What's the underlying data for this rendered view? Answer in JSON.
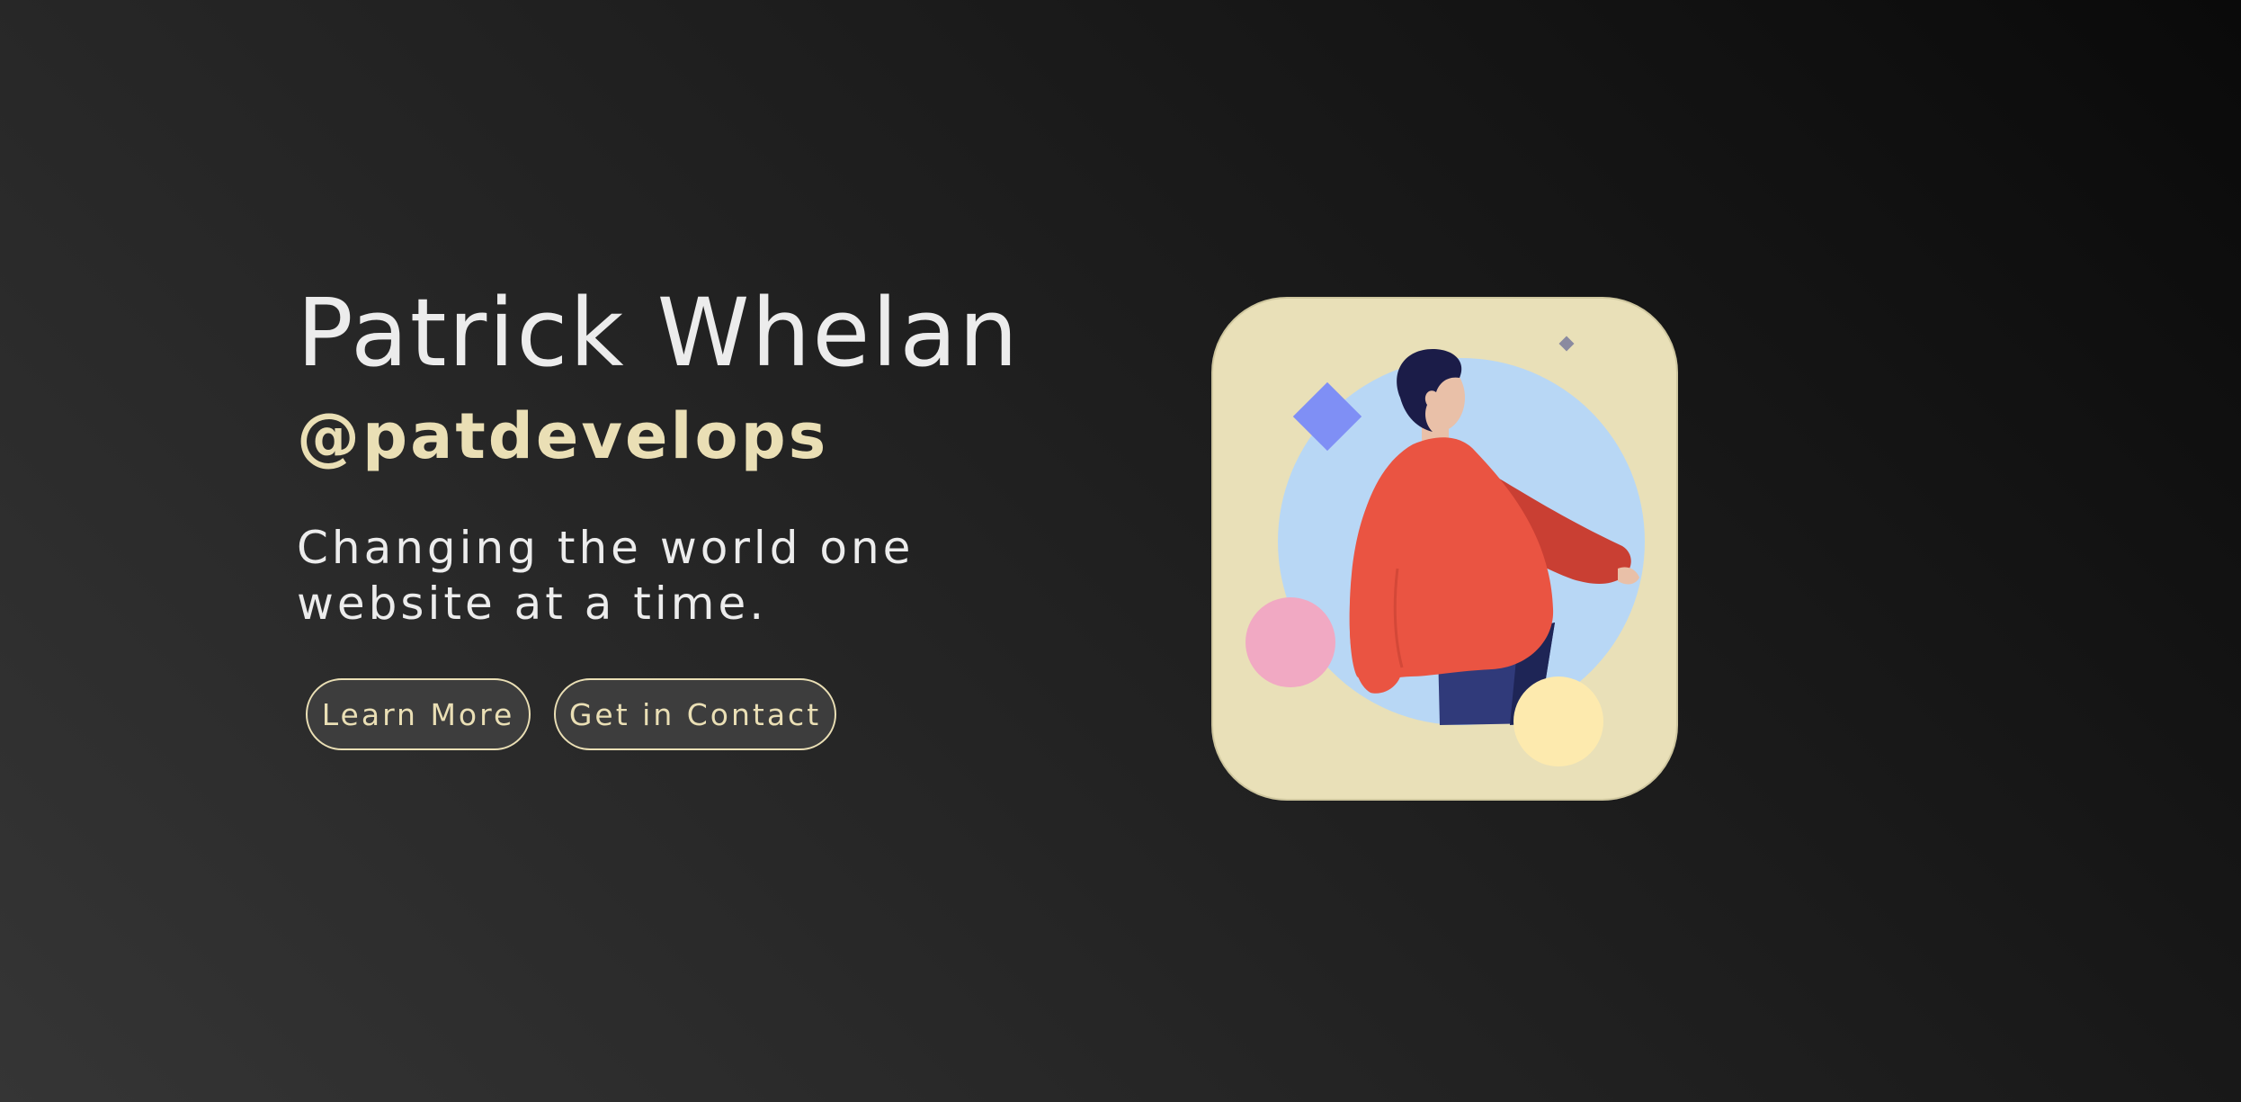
{
  "profile": {
    "name": "Patrick Whelan",
    "handle": "@patdevelops",
    "tagline": "Changing the world one website at a time."
  },
  "actions": {
    "learn_more": "Learn More",
    "get_in_contact": "Get in Contact"
  },
  "avatar": {
    "icon": "person-illustration",
    "colors": {
      "card": "#e9e0b8",
      "circle": "#b8d7f5",
      "shirt": "#ea5442",
      "sleeve": "#c93f33",
      "pants": "#303a7a",
      "hair": "#1b1c48",
      "skin": "#e9c0a8",
      "diamond": "#7f8ff5",
      "pink_circle": "#f1a9c3",
      "yellow_circle": "#fdeaae"
    }
  },
  "theme": {
    "text": "#ececec",
    "accent": "#eadfb5",
    "button_bg": "#3d3d3d"
  }
}
